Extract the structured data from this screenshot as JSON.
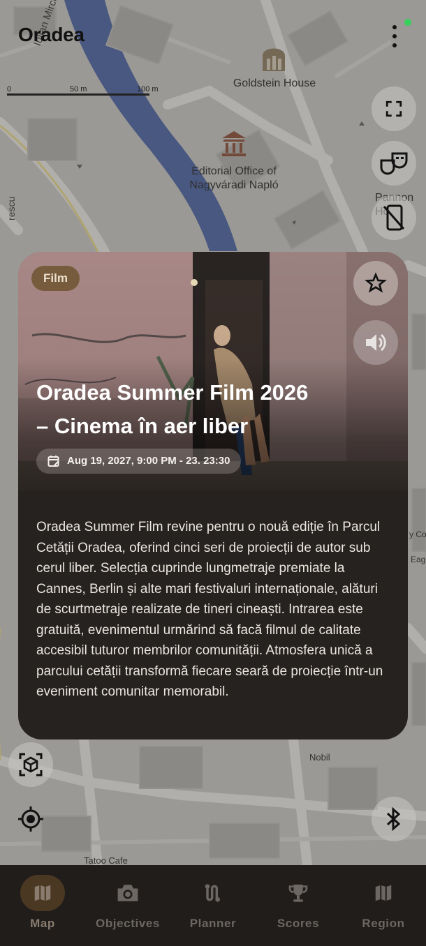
{
  "app": {
    "title": "Oradea",
    "status_color": "#35d15a"
  },
  "map": {
    "scale": {
      "label0": "0",
      "label1": "50 m",
      "label2": "100 m"
    },
    "labels": {
      "goldstein": "Goldstein House",
      "editorial_line1": "Editorial Office of",
      "editorial_line2": "Nagyváradi Napló",
      "street_chiril": "Iulian Mircea Chiril",
      "street_escu": "rescu",
      "pannon": "Pannon Ho",
      "nobil": "Nobil",
      "tatoo": "Tatoo Cafe",
      "right_cot": "y Cot",
      "right_eag": "Eag"
    },
    "controls": {
      "fullscreen_icon": "fullscreen-icon",
      "theater_icon": "theater-masks-icon",
      "no_phone_icon": "phone-off-icon",
      "ar_icon": "ar-cube-icon",
      "location_icon": "my-location-icon",
      "bluetooth_icon": "bluetooth-icon"
    }
  },
  "event": {
    "category": "Film",
    "title_line1": "Oradea Summer Film 2026",
    "title_line2": "– Cinema în aer liber",
    "date": "Aug 19, 2027, 9:00 PM - 23. 23:30",
    "description": "Oradea Summer Film revine pentru o nouă ediție în Parcul Cetății Oradea, oferind cinci seri de proiecții de autor sub cerul liber. Selecția cuprinde lungmetraje premiate la Cannes, Berlin și alte mari festivaluri internaționale, alături de scurtmetraje realizate de tineri cineaști. Intrarea este gratuită, evenimentul urmărind să facă filmul de calitate accesibil tuturor membrilor comunității. Atmosfera unică a parcului cetății transformă fiecare seară de proiecție într-un eveniment comunitar memorabil.",
    "favorite_icon": "star-outline-icon",
    "audio_icon": "volume-icon"
  },
  "nav": {
    "items": [
      {
        "label": "Map",
        "icon": "map-icon",
        "active": true
      },
      {
        "label": "Objectives",
        "icon": "camera-icon",
        "active": false
      },
      {
        "label": "Planner",
        "icon": "route-icon",
        "active": false
      },
      {
        "label": "Scores",
        "icon": "trophy-icon",
        "active": false
      },
      {
        "label": "Region",
        "icon": "map-icon",
        "active": false
      }
    ]
  },
  "colors": {
    "card_bg": "#25221f",
    "nav_bg": "#201d1b",
    "chip_bg": "#6e5430",
    "active_nav": "#4b3822"
  }
}
